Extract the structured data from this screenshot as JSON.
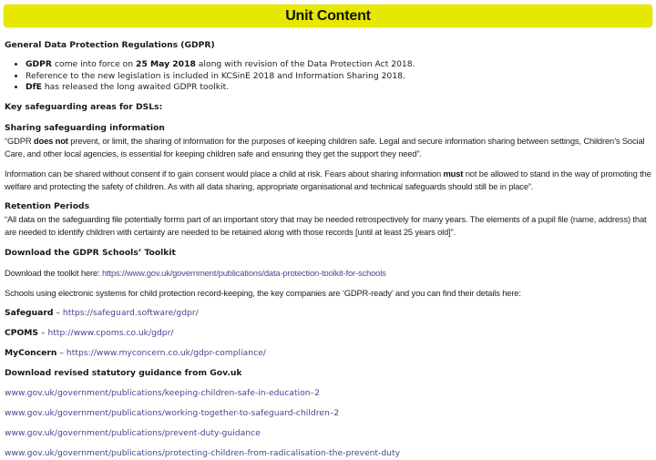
{
  "banner": {
    "title": "Unit Content",
    "color": "#e6e800"
  },
  "gdpr": {
    "heading": "General Data Protection Regulations (GDPR)",
    "bullets": [
      {
        "bold1": "GDPR",
        "text1": " come into force on ",
        "bold2": "25 May 2018",
        "text2": " along with revision of the Data Protection Act 2018."
      },
      {
        "text": "Reference to the new legislation is included in KCSinE 2018 and Information Sharing 2018."
      },
      {
        "bold": "DfE",
        "text": " has released the long awaited GDPR toolkit."
      }
    ]
  },
  "key_areas": {
    "heading": "Key safeguarding areas for DSLs:"
  },
  "sharing": {
    "heading": "Sharing safeguarding information",
    "para1_a": "“GDPR ",
    "para1_bold": "does not",
    "para1_b": " prevent, or limit, the sharing of information for the purposes of keeping children safe. Legal and secure information sharing between settings, Children’s Social Care, and other local agencies, is essential for keeping children safe and ensuring they get the support they need”.",
    "para2_a": "Information can be shared without consent if to gain consent would place a child at risk. Fears about sharing information ",
    "para2_bold": "must",
    "para2_b": " not be allowed to stand in the way of promoting the welfare and protecting the safety of children. As with all data sharing, appropriate organisational and technical safeguards should still be in place”."
  },
  "retention": {
    "heading": "Retention Periods",
    "text": "“All data on the safeguarding file potentially forms part of an important story that may be needed retrospectively for many years. The elements of a pupil file (name, address) that are needed to identify children with certainty are needed to be retained along with those records [until at least 25 years old]”."
  },
  "toolkit": {
    "heading": "Download the GDPR Schools’ Toolkit",
    "prefix": "Download the toolkit here: ",
    "link": "https://www.gov.uk/government/publications/data-protection-toolkit-for-schools",
    "companies_intro": "Schools using electronic systems for child protection record-keeping, the key companies are ‘GDPR-ready’ and you can find their details here:",
    "companies": [
      {
        "name": "Safeguard",
        "sep": " – ",
        "link": "https://safeguard.software/gdpr/"
      },
      {
        "name": "CPOMS",
        "sep": " – ",
        "link": "http://www.cpoms.co.uk/gdpr/"
      },
      {
        "name": "MyConcern",
        "sep": " – ",
        "link": "https://www.myconcern.co.uk/gdpr-compliance/"
      }
    ]
  },
  "guidance": {
    "heading": "Download revised statutory guidance from Gov.uk",
    "links": [
      "www.gov.uk/government/publications/keeping-children-safe-in-education–2",
      "www.gov.uk/government/publications/working-together-to-safeguard-children–2",
      "www.gov.uk/government/publications/prevent-duty-guidance",
      "www.gov.uk/government/publications/protecting-children-from-radicalisation-the-prevent-duty"
    ]
  },
  "colors": {
    "link": "#4a4590",
    "text": "#222222"
  }
}
